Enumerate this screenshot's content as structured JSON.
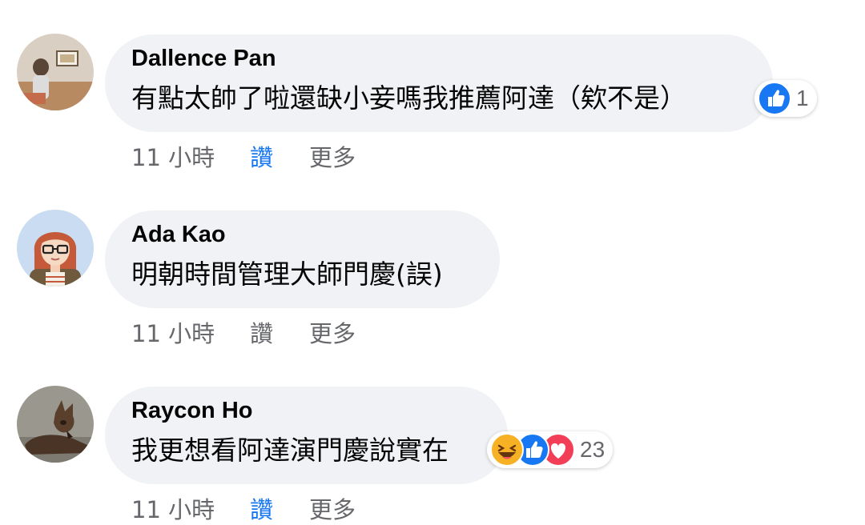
{
  "comments": [
    {
      "author": "Dallence Pan",
      "text": "有點太帥了啦還缺小妾嗎我推薦阿達（欸不是）",
      "time": "11 小時",
      "like_label": "讚",
      "more_label": "更多",
      "liked": true,
      "reactions": [
        "like-icon"
      ],
      "reaction_count": "1"
    },
    {
      "author": "Ada Kao",
      "text": "明朝時間管理大師門慶(誤)",
      "time": "11 小時",
      "like_label": "讚",
      "more_label": "更多",
      "liked": false,
      "reactions": [],
      "reaction_count": ""
    },
    {
      "author": "Raycon Ho",
      "text": "我更想看阿達演門慶說實在",
      "time": "11 小時",
      "like_label": "讚",
      "more_label": "更多",
      "liked": true,
      "reactions": [
        "haha-icon",
        "like-icon",
        "love-icon"
      ],
      "reaction_count": "23"
    }
  ],
  "colors": {
    "bubble": "#f0f2f5",
    "text": "#050505",
    "meta": "#65676b",
    "liked": "#1877f2",
    "like_reaction": "#1877f2",
    "love_reaction": "#f33e58",
    "haha_reaction": "#f7b125"
  }
}
